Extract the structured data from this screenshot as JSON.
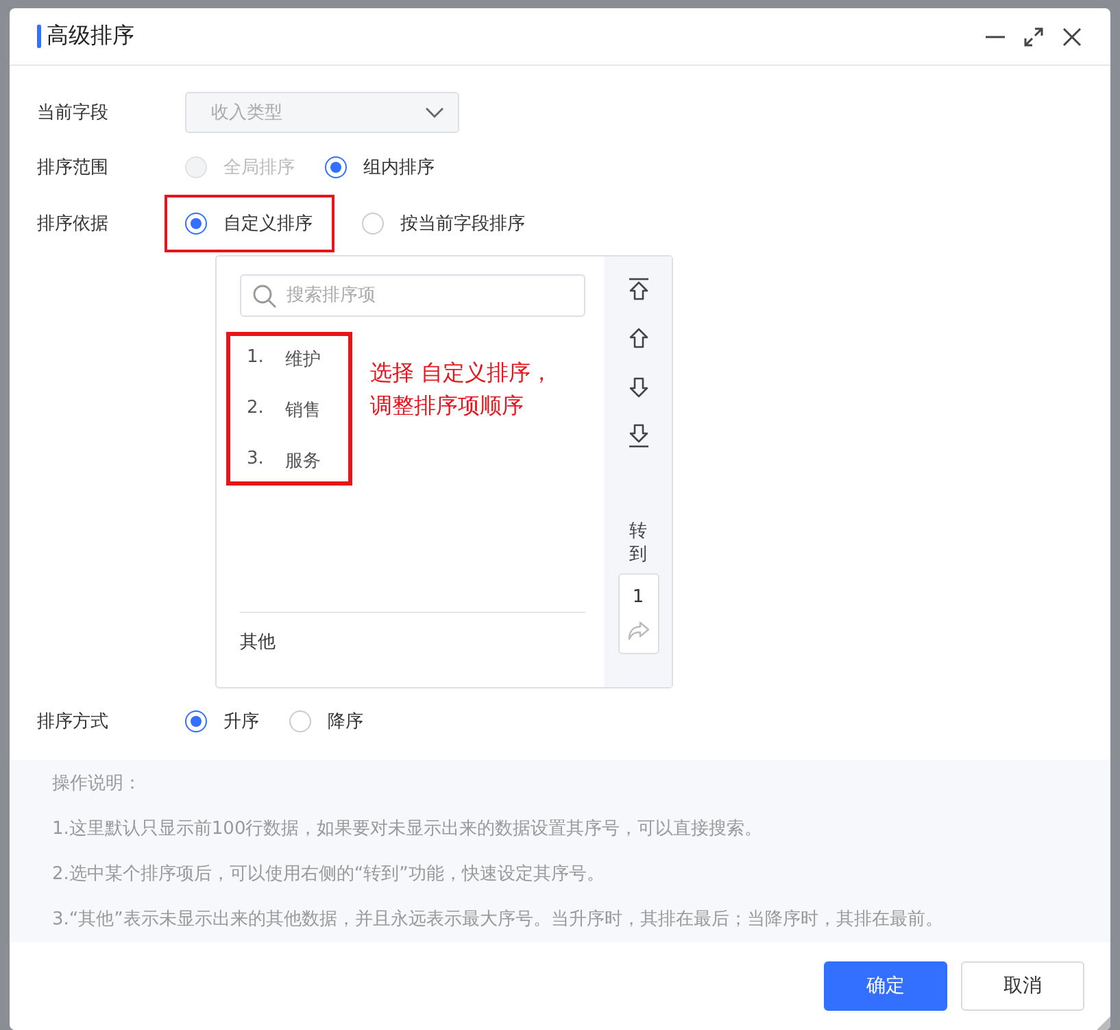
{
  "dialog": {
    "title": "高级排序"
  },
  "current_field": {
    "label": "当前字段",
    "value": "收入类型",
    "disabled": true
  },
  "sort_scope": {
    "label": "排序范围",
    "options": [
      {
        "label": "全局排序",
        "selected": false,
        "disabled": true
      },
      {
        "label": "组内排序",
        "selected": true,
        "disabled": false
      }
    ]
  },
  "sort_basis": {
    "label": "排序依据",
    "options": [
      {
        "label": "自定义排序",
        "selected": true,
        "disabled": false,
        "highlighted": true
      },
      {
        "label": "按当前字段排序",
        "selected": false,
        "disabled": false,
        "highlighted": false
      }
    ]
  },
  "sort_list": {
    "search": {
      "placeholder": "搜索排序项"
    },
    "items": [
      {
        "number": "1.",
        "label": "维护"
      },
      {
        "number": "2.",
        "label": "销售"
      },
      {
        "number": "3.",
        "label": "服务"
      }
    ],
    "other": "其他",
    "goto_label": "转到",
    "goto_value": "1"
  },
  "annotation": [
    "选择 自定义排序，",
    "调整排序项顺序"
  ],
  "sort_order": {
    "label": "排序方式",
    "options": [
      {
        "label": "升序",
        "selected": true,
        "disabled": false
      },
      {
        "label": "降序",
        "selected": false,
        "disabled": false
      }
    ]
  },
  "notes": {
    "title": "操作说明：",
    "lines": [
      "1.这里默认只显示前100行数据，如果要对未显示出来的数据设置其序号，可以直接搜索。",
      "2.选中某个排序项后，可以使用右侧的“转到”功能，快速设定其序号。",
      "3.“其他”表示未显示出来的其他数据，并且永远表示最大序号。当升序时，其排在最后；当降序时，其排在最前。"
    ]
  },
  "buttons": [
    {
      "label": "确定",
      "kind": "primary"
    },
    {
      "label": "取消",
      "kind": "secondary"
    }
  ]
}
